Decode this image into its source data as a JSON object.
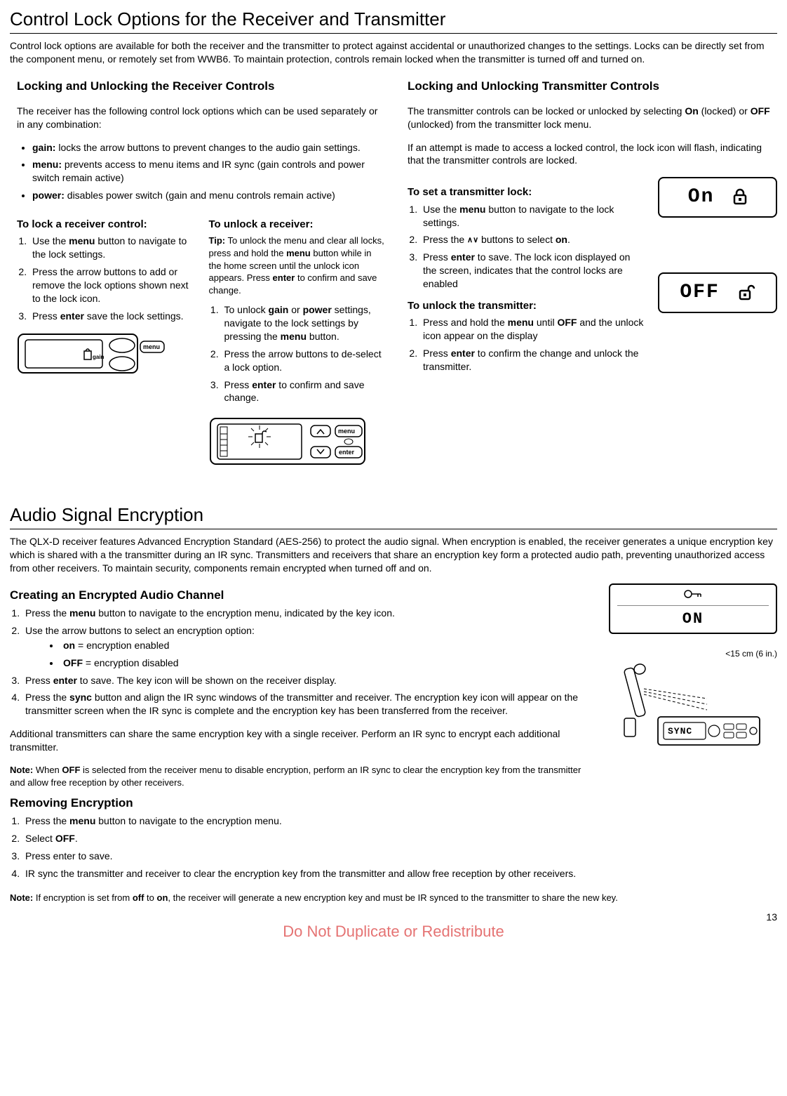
{
  "page_number": "13",
  "watermark": "Do Not Duplicate or Redistribute",
  "s1": {
    "title": "Control Lock Options for the Receiver and Transmitter",
    "intro": "Control lock options are available for both the receiver and the transmitter to protect against accidental or unauthorized changes to the settings. Locks can be directly set from the component menu, or remotely set from WWB6. To maintain protection, controls remain locked when the transmitter is turned off and turned on.",
    "left": {
      "heading": "Locking and Unlocking the Receiver Controls",
      "desc": "The receiver has the following control lock options which can be used separately or in any combination:",
      "b1a": "gain:",
      "b1b": " locks the arrow buttons to prevent changes to the audio gain settings.",
      "b2a": "menu:",
      "b2b": " prevents access to menu items and IR sync (gain controls and power switch remain active)",
      "b3a": "power:",
      "b3b": " disables power switch (gain and menu controls remain active)",
      "lock_h": "To lock a receiver control:",
      "l1a": "Use the ",
      "l1b": "menu",
      "l1c": " button to navigate to the lock settings.",
      "l2": "Press the arrow buttons to add or remove the lock options shown next to the lock icon.",
      "l3a": "Press ",
      "l3b": "enter",
      "l3c": " save the lock settings.",
      "unlock_h": "To unlock a receiver:",
      "tip_a": "Tip:",
      "tip_b": " To unlock the menu and clear all locks, press and hold the ",
      "tip_c": "menu",
      "tip_d": " button while in the home screen until the unlock icon appears. Press ",
      "tip_e": "enter",
      "tip_f": " to confirm and save change.",
      "u1a": "To unlock ",
      "u1b": "gain",
      "u1c": " or ",
      "u1d": "power",
      "u1e": " settings, navigate to the lock settings by pressing the ",
      "u1f": "menu",
      "u1g": " button.",
      "u2": "Press the arrow buttons to de-select a lock option.",
      "u3a": "Press ",
      "u3b": "enter",
      "u3c": " to confirm and save change.",
      "gain_label": "gain",
      "menu_label": "menu",
      "enter_label": "enter"
    },
    "right": {
      "heading": "Locking and Unlocking Transmitter Controls",
      "p1a": "The transmitter controls can be locked or unlocked by selecting ",
      "p1b": "On",
      "p1c": " (locked) or ",
      "p1d": "OFF",
      "p1e": " (unlocked) from the transmitter lock menu.",
      "p2": "If an attempt is made to access a locked control, the lock icon will flash, indicating that the transmitter controls are locked.",
      "set_h": "To set a transmitter lock:",
      "s1a": "Use the ",
      "s1b": "menu",
      "s1c": " button to navigate to the lock settings.",
      "s2a": "Press the ",
      "s2b": " buttons to select ",
      "s2c": "on",
      "s2d": ".",
      "s3a": "Press ",
      "s3b": "enter",
      "s3c": " to save. The lock icon displayed on the screen, indicates that the control locks are enabled",
      "unlock_h": "To unlock the transmitter:",
      "u1a": "Press and hold the ",
      "u1b": "menu",
      "u1c": " until ",
      "u1d": "OFF",
      "u1e": " and the unlock icon appear on the display",
      "u2a": "Press ",
      "u2b": "enter",
      "u2c": " to confirm the change and unlock the transmitter.",
      "lcd_on": "On",
      "lcd_off": "OFF"
    }
  },
  "s2": {
    "title": "Audio Signal Encryption",
    "intro": "The QLX-D receiver features Advanced Encryption Standard (AES-256) to protect the audio signal. When encryption is enabled, the receiver generates a unique encryption key which is shared with a the transmitter during an IR sync. Transmitters and receivers that share an encryption key form a protected audio path, preventing unauthorized access from other receivers. To maintain security, components remain encrypted when turned off and on.",
    "create_h": "Creating an Encrypted Audio Channel",
    "c1a": "Press the ",
    "c1b": "menu",
    "c1c": " button to navigate to the encryption menu, indicated by the key icon.",
    "c2": "Use the arrow buttons to select an encryption option:",
    "opt_on_a": "on",
    "opt_on_b": " = encryption enabled",
    "opt_off_a": "OFF",
    "opt_off_b": " = encryption disabled",
    "c3a": "Press ",
    "c3b": "enter",
    "c3c": " to save. The key icon will be shown on the receiver display.",
    "c4a": "Press the ",
    "c4b": "sync",
    "c4c": " button and align the IR sync windows of the transmitter and receiver. The encryption key icon will appear on the transmitter screen when the IR sync is complete and the encryption key has been transferred from the receiver.",
    "c_add": "Additional transmitters can share the same encryption key with a single receiver. Perform an IR sync to encrypt each additional transmitter.",
    "c_note_a": "Note:",
    "c_note_b": " When ",
    "c_note_c": "OFF",
    "c_note_d": " is selected from the receiver menu to disable encryption, perform an IR sync to clear the encryption key from the transmitter and allow free reception by other receivers.",
    "remove_h": "Removing Encryption",
    "r1a": "Press the ",
    "r1b": "menu",
    "r1c": " button to navigate to the encryption menu.",
    "r2a": "Select ",
    "r2b": "OFF",
    "r2c": ".",
    "r3": "Press enter to save.",
    "r4": "IR sync the transmitter and receiver to clear the encryption key from the transmitter and allow free reception by other receivers.",
    "r_note_a": "Note:",
    "r_note_b": " If encryption is set from ",
    "r_note_c": "off",
    "r_note_d": " to ",
    "r_note_e": "on",
    "r_note_f": ", the receiver will generate a new encryption key and must be IR synced to the transmitter to share the new key.",
    "lcd_on": "ON",
    "sync_dist": "<15 cm (6 in.)",
    "sync_label": "SYNC"
  }
}
